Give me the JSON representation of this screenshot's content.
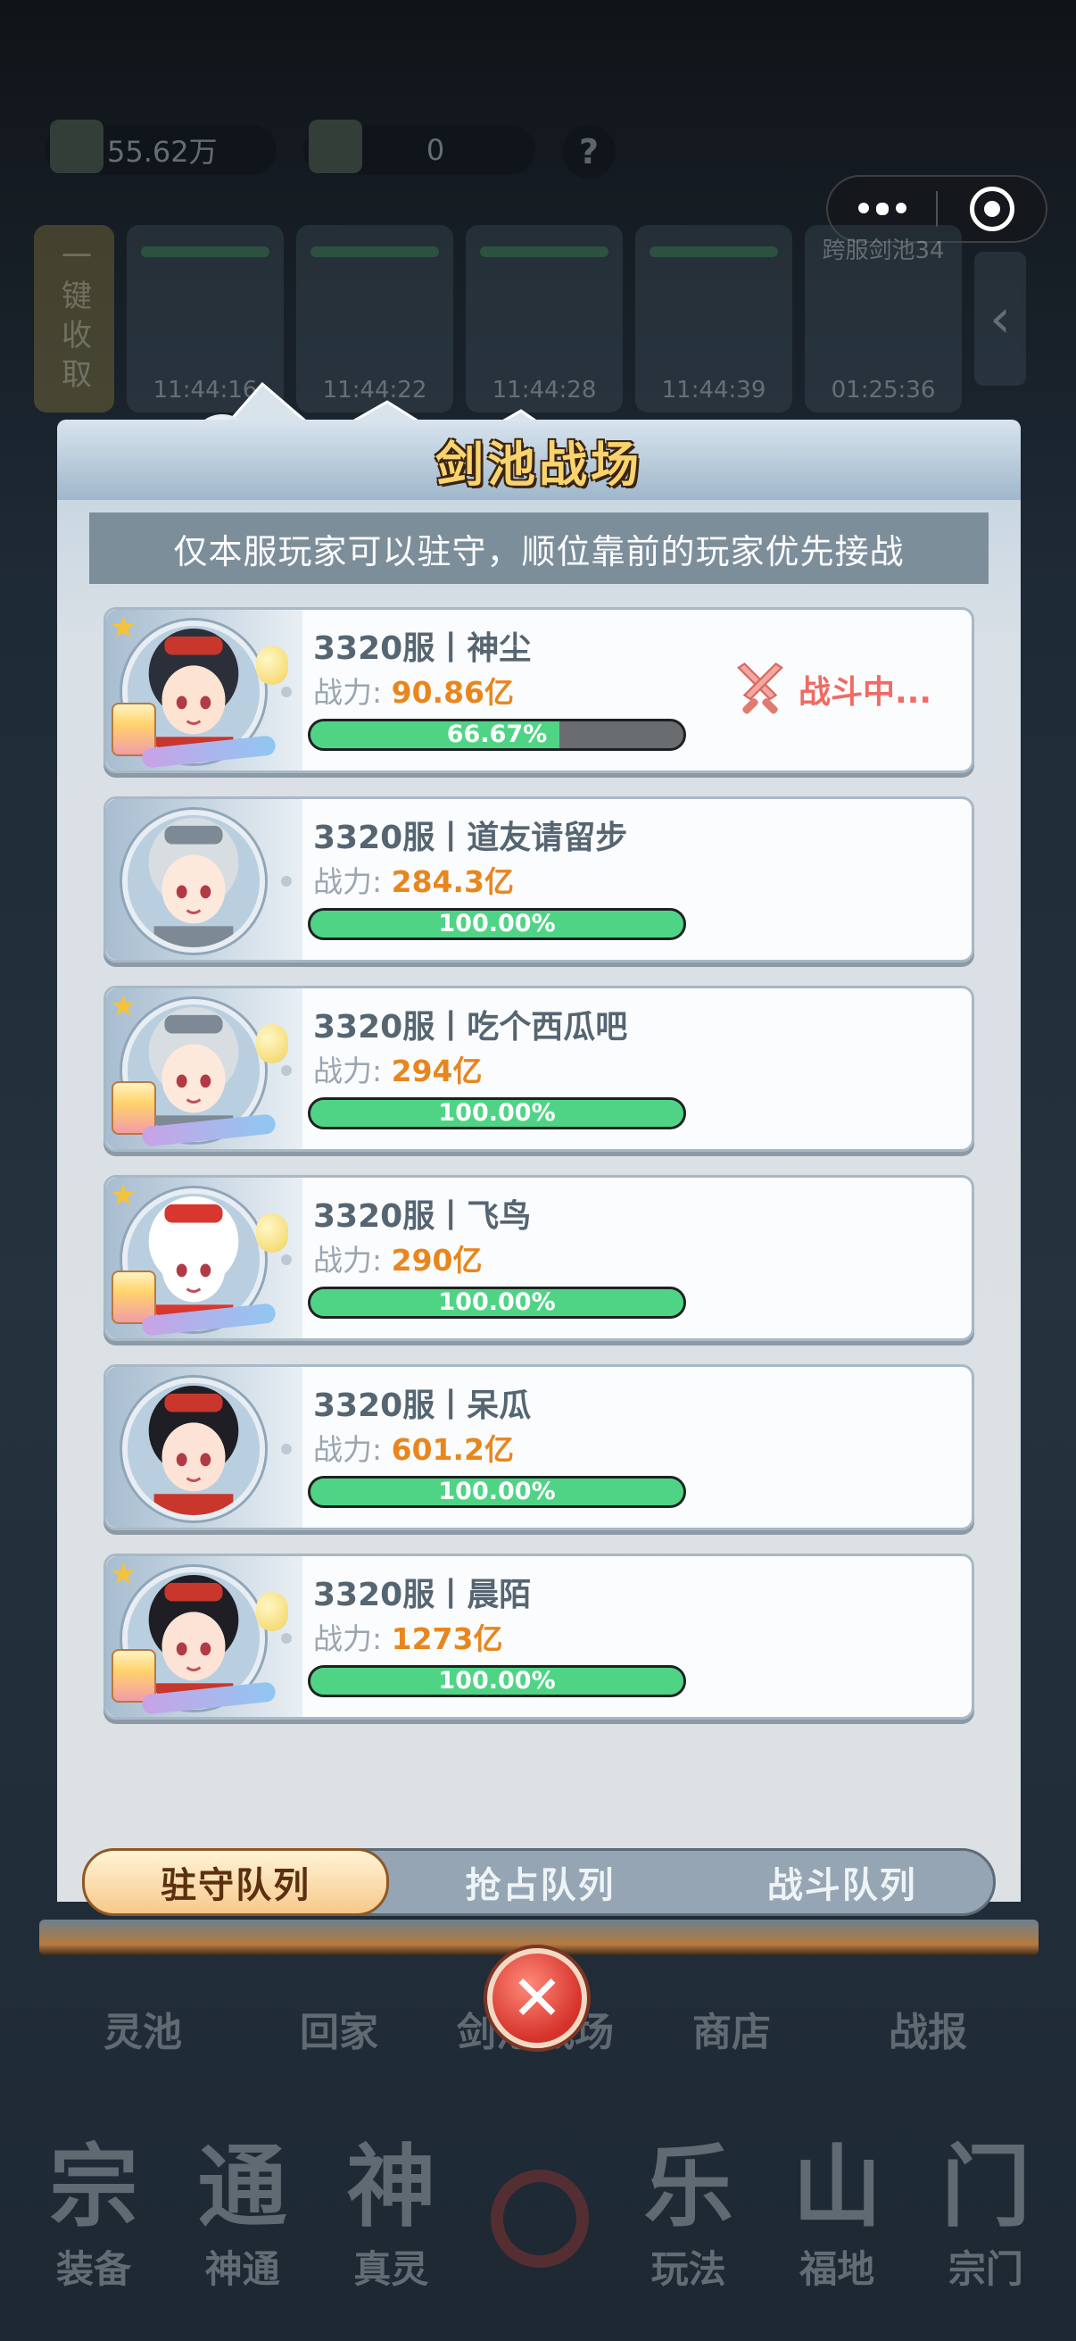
{
  "topbar": {
    "resource1_value": "55.62万",
    "resource2_value": "0",
    "help_glyph": "?"
  },
  "collect_all_label": "一键收取",
  "slots": [
    {
      "time": "11:44:16"
    },
    {
      "time": "11:44:22"
    },
    {
      "time": "11:44:28"
    },
    {
      "time": "11:44:39"
    },
    {
      "title": "跨服剑池34",
      "time": "01:25:36"
    }
  ],
  "slot_arrow_glyph": "‹",
  "modal": {
    "title": "剑池战场",
    "notice": "仅本服玩家可以驻守，顺位靠前的玩家优先接战",
    "power_label": "战力:",
    "fighting_label": "战斗中...",
    "players": [
      {
        "name": "3320服丨神尘",
        "power": "90.86亿",
        "hp_text": "66.67%",
        "hp": 0.6667,
        "fighting": true
      },
      {
        "name": "3320服丨道友请留步",
        "power": "284.3亿",
        "hp_text": "100.00%",
        "hp": 1.0
      },
      {
        "name": "3320服丨吃个西瓜吧",
        "power": "294亿",
        "hp_text": "100.00%",
        "hp": 1.0
      },
      {
        "name": "3320服丨飞鸟",
        "power": "290亿",
        "hp_text": "100.00%",
        "hp": 1.0
      },
      {
        "name": "3320服丨呆瓜",
        "power": "601.2亿",
        "hp_text": "100.00%",
        "hp": 1.0
      },
      {
        "name": "3320服丨晨陌",
        "power": "1273亿",
        "hp_text": "100.00%",
        "hp": 1.0
      }
    ],
    "tabs": [
      {
        "label": "驻守队列",
        "active": true
      },
      {
        "label": "抢占队列",
        "active": false
      },
      {
        "label": "战斗队列",
        "active": false
      }
    ],
    "close_glyph": "✕"
  },
  "bottom_row1": [
    "灵池",
    "回家",
    "剑池战场",
    "商店",
    "战报"
  ],
  "bottom_nav": [
    {
      "glyph": "宗",
      "label": "装备"
    },
    {
      "glyph": "通",
      "label": "神通"
    },
    {
      "glyph": "神",
      "label": "真灵"
    },
    {
      "glyph": "",
      "label": ""
    },
    {
      "glyph": "乐",
      "label": "玩法"
    },
    {
      "glyph": "山",
      "label": "福地"
    },
    {
      "glyph": "门",
      "label": "宗门"
    }
  ],
  "colors": {
    "hp_fill": "#4fd485",
    "hp_empty": "#6a6d70",
    "power_value": "#e8861e",
    "fighting_text": "#ef6b63",
    "title": "#f9d36d",
    "close_red": "#d5322a"
  },
  "icons": {
    "more": "more-dots-icon",
    "exit": "target-circle-icon",
    "close": "close-icon",
    "fighting": "crossed-swords-icon",
    "help": "question-icon"
  }
}
